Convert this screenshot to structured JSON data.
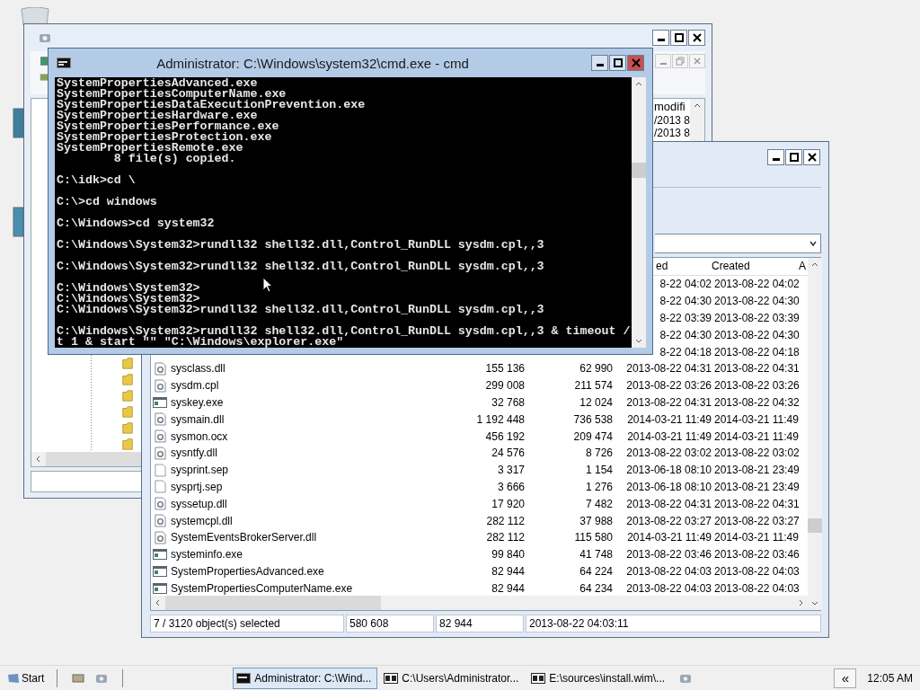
{
  "background_window": {
    "column_header": "modifi",
    "cells": [
      "/2013 8",
      "/2013 8"
    ]
  },
  "cmd_window": {
    "title": "Administrator: C:\\Windows\\system32\\cmd.exe - cmd",
    "blocks": [
      [
        "SystemPropertiesAdvanced.exe",
        "SystemPropertiesComputerName.exe",
        "SystemPropertiesDataExecutionPrevention.exe",
        "SystemPropertiesHardware.exe",
        "SystemPropertiesPerformance.exe",
        "SystemPropertiesProtection.exe",
        "SystemPropertiesRemote.exe",
        "        8 file(s) copied."
      ],
      [
        "C:\\idk>cd \\"
      ],
      [
        "C:\\>cd windows"
      ],
      [
        "C:\\Windows>cd system32"
      ],
      [
        "C:\\Windows\\System32>rundll32 shell32.dll,Control_RunDLL sysdm.cpl,,3"
      ],
      [
        "C:\\Windows\\System32>rundll32 shell32.dll,Control_RunDLL sysdm.cpl,,3"
      ],
      [
        "C:\\Windows\\System32>",
        "C:\\Windows\\System32>",
        "C:\\Windows\\System32>rundll32 shell32.dll,Control_RunDLL sysdm.cpl,,3"
      ],
      [
        "C:\\Windows\\System32>rundll32 shell32.dll,Control_RunDLL sysdm.cpl,,3 & timeout /",
        "t 1 & start \"\" \"C:\\Windows\\explorer.exe\""
      ]
    ]
  },
  "file_window": {
    "columns": [
      {
        "label": "ed"
      },
      {
        "label": "Created"
      },
      {
        "label": "A"
      }
    ],
    "rows": [
      {
        "modified": "8-22 04:02",
        "created": "2013-08-22 04:02"
      },
      {
        "modified": "8-22 04:30",
        "created": "2013-08-22 04:30"
      },
      {
        "modified": "8-22 03:39",
        "created": "2013-08-22 03:39"
      },
      {
        "modified": "8-22 04:30",
        "created": "2013-08-22 04:30"
      },
      {
        "modified": "8-22 04:18",
        "created": "2013-08-22 04:18"
      },
      {
        "kind": "dll",
        "name": "sysclass.dll",
        "size": "155 136",
        "packed": "62 990",
        "modified": "2013-08-22 04:31",
        "created": "2013-08-22 04:31"
      },
      {
        "kind": "dll",
        "name": "sysdm.cpl",
        "size": "299 008",
        "packed": "211 574",
        "modified": "2013-08-22 03:26",
        "created": "2013-08-22 03:26"
      },
      {
        "kind": "exe",
        "name": "syskey.exe",
        "size": "32 768",
        "packed": "12 024",
        "modified": "2013-08-22 04:31",
        "created": "2013-08-22 04:32"
      },
      {
        "kind": "dll",
        "name": "sysmain.dll",
        "size": "1 192 448",
        "packed": "736 538",
        "modified": "2014-03-21 11:49",
        "created": "2014-03-21 11:49"
      },
      {
        "kind": "dll",
        "name": "sysmon.ocx",
        "size": "456 192",
        "packed": "209 474",
        "modified": "2014-03-21 11:49",
        "created": "2014-03-21 11:49"
      },
      {
        "kind": "dll",
        "name": "sysntfy.dll",
        "size": "24 576",
        "packed": "8 726",
        "modified": "2013-08-22 03:02",
        "created": "2013-08-22 03:02"
      },
      {
        "kind": "file",
        "name": "sysprint.sep",
        "size": "3 317",
        "packed": "1 154",
        "modified": "2013-06-18 08:10",
        "created": "2013-08-21 23:49"
      },
      {
        "kind": "file",
        "name": "sysprtj.sep",
        "size": "3 666",
        "packed": "1 276",
        "modified": "2013-06-18 08:10",
        "created": "2013-08-21 23:49"
      },
      {
        "kind": "dll",
        "name": "syssetup.dll",
        "size": "17 920",
        "packed": "7 482",
        "modified": "2013-08-22 04:31",
        "created": "2013-08-22 04:31"
      },
      {
        "kind": "dll",
        "name": "systemcpl.dll",
        "size": "282 112",
        "packed": "37 988",
        "modified": "2013-08-22 03:27",
        "created": "2013-08-22 03:27"
      },
      {
        "kind": "dll",
        "name": "SystemEventsBrokerServer.dll",
        "size": "282 112",
        "packed": "115 580",
        "modified": "2014-03-21 11:49",
        "created": "2014-03-21 11:49"
      },
      {
        "kind": "exe",
        "name": "systeminfo.exe",
        "size": "99 840",
        "packed": "41 748",
        "modified": "2013-08-22 03:46",
        "created": "2013-08-22 03:46"
      },
      {
        "kind": "exe",
        "name": "SystemPropertiesAdvanced.exe",
        "size": "82 944",
        "packed": "64 224",
        "modified": "2013-08-22 04:03",
        "created": "2013-08-22 04:03"
      },
      {
        "kind": "exe",
        "name": "SystemPropertiesComputerName.exe",
        "size": "82 944",
        "packed": "64 234",
        "modified": "2013-08-22 04:03",
        "created": "2013-08-22 04:03"
      }
    ],
    "status_bar": [
      "7 / 3120 object(s) selected",
      "580 608",
      "82 944",
      "2013-08-22 04:03:11"
    ]
  },
  "taskbar": {
    "start": "Start",
    "tasks": [
      {
        "kind": "cmd",
        "label": "Administrator: C:\\Wind...",
        "selected": true
      },
      {
        "kind": "archive",
        "label": "C:\\Users\\Administrator...",
        "selected": false
      },
      {
        "kind": "archive",
        "label": "E:\\sources\\install.wim\\...",
        "selected": false
      }
    ],
    "tray_button": "«",
    "clock": "12:05 AM"
  }
}
